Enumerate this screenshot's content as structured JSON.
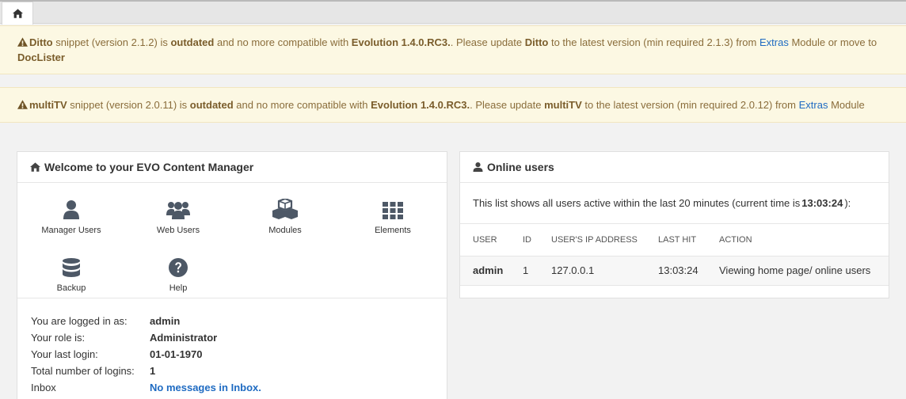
{
  "alerts": [
    {
      "name": "Ditto",
      "t1": " snippet (version 2.1.2) is ",
      "outdated": "outdated",
      "t2": " and no more compatible with ",
      "evo": "Evolution 1.4.0.RC3.",
      "t3": ". Please update ",
      "name2": "Ditto",
      "t4": " to the latest version (min required 2.1.3) from ",
      "link": "Extras",
      "t5": " Module or move to ",
      "tail": "DocLister"
    },
    {
      "name": "multiTV",
      "t1": " snippet (version 2.0.11) is ",
      "outdated": "outdated",
      "t2": " and no more compatible with ",
      "evo": "Evolution 1.4.0.RC3.",
      "t3": ". Please update ",
      "name2": "multiTV",
      "t4": " to the latest version (min required 2.0.12) from ",
      "link": "Extras",
      "t5": " Module",
      "tail": ""
    }
  ],
  "welcome": {
    "title": "Welcome to your EVO Content Manager",
    "shortcuts": [
      {
        "label": "Manager Users",
        "icon": "user-icon"
      },
      {
        "label": "Web Users",
        "icon": "users-icon"
      },
      {
        "label": "Modules",
        "icon": "cubes-icon"
      },
      {
        "label": "Elements",
        "icon": "grid-icon"
      },
      {
        "label": "Backup",
        "icon": "database-icon"
      },
      {
        "label": "Help",
        "icon": "question-icon"
      }
    ],
    "info": [
      {
        "key": "You are logged in as:",
        "value": "admin"
      },
      {
        "key": "Your role is:",
        "value": "Administrator"
      },
      {
        "key": "Your last login:",
        "value": "01-01-1970"
      },
      {
        "key": "Total number of logins:",
        "value": "1"
      },
      {
        "key": "Inbox",
        "value": "No messages in Inbox."
      }
    ]
  },
  "online": {
    "title": "Online users",
    "desc_pre": "This list shows all users active within the last 20 minutes (current time is ",
    "time": "13:03:24",
    "desc_post": "):",
    "columns": [
      "USER",
      "ID",
      "USER'S IP ADDRESS",
      "LAST HIT",
      "ACTION"
    ],
    "rows": [
      {
        "user": "admin",
        "id": "1",
        "ip": "127.0.0.1",
        "last_hit": "13:03:24",
        "action": "Viewing home page/ online users"
      }
    ]
  },
  "colors": {
    "alert_bg": "#fcf8e3",
    "alert_text": "#8a6d3b",
    "link": "#1f6bc2",
    "icon": "#4d5866"
  }
}
